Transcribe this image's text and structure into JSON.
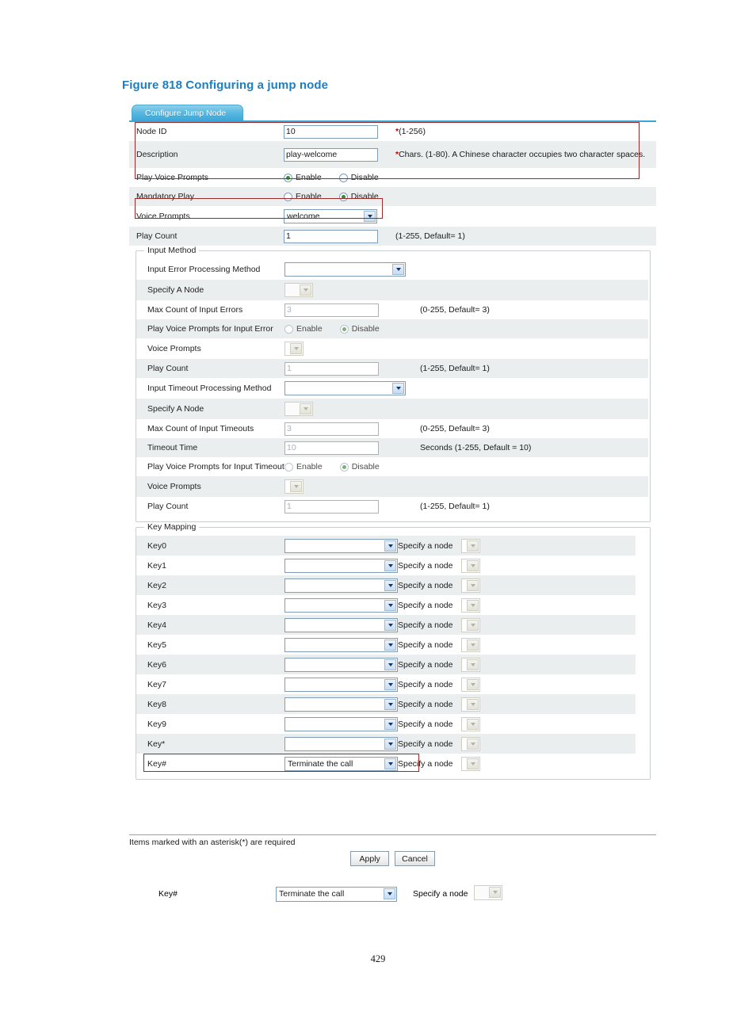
{
  "figure": {
    "caption": "Figure 818 Configuring a jump node"
  },
  "tab": {
    "label": "Configure Jump Node"
  },
  "basic": {
    "rows": [
      {
        "label": "Node ID",
        "value": "10",
        "hint_asterisk": "*",
        "hint": "(1-256)"
      },
      {
        "label": "Description",
        "value": "play-welcome",
        "hint_asterisk": "*",
        "hint": "Chars. (1-80). A Chinese character occupies two character spaces."
      },
      {
        "label": "Play Voice Prompts",
        "enable_label": "Enable",
        "disable_label": "Disable",
        "selected": "Enable"
      },
      {
        "label": "Mandatory Play",
        "enable_label": "Enable",
        "disable_label": "Disable",
        "selected": "Disable"
      },
      {
        "label": "Voice Prompts",
        "value": "welcome"
      },
      {
        "label": "Play Count",
        "value": "1",
        "hint": "(1-255, Default= 1)"
      }
    ]
  },
  "input_method": {
    "legend": "Input Method",
    "rows": [
      {
        "label": "Input Error Processing Method",
        "value": ""
      },
      {
        "label": "Specify A Node",
        "value": ""
      },
      {
        "label": "Max Count of Input Errors",
        "value": "3",
        "hint": "(0-255, Default= 3)"
      },
      {
        "label": "Play Voice Prompts for Input Error",
        "enable_label": "Enable",
        "disable_label": "Disable",
        "selected": "Disable"
      },
      {
        "label": "Voice Prompts",
        "value": ""
      },
      {
        "label": "Play Count",
        "value": "1",
        "hint": "(1-255, Default= 1)"
      },
      {
        "label": "Input Timeout Processing Method",
        "value": ""
      },
      {
        "label": "Specify A Node",
        "value": ""
      },
      {
        "label": "Max Count of Input Timeouts",
        "value": "3",
        "hint": "(0-255, Default= 3)"
      },
      {
        "label": "Timeout Time",
        "value": "10",
        "hint": "Seconds (1-255, Default = 10)"
      },
      {
        "label": "Play Voice Prompts for Input Timeout",
        "enable_label": "Enable",
        "disable_label": "Disable",
        "selected": "Disable"
      },
      {
        "label": "Voice Prompts",
        "value": ""
      },
      {
        "label": "Play Count",
        "value": "1",
        "hint": "(1-255, Default= 1)"
      }
    ]
  },
  "key_mapping": {
    "legend": "Key Mapping",
    "specify_node_label": "Specify a node",
    "rows": [
      {
        "label": "Key0",
        "value": ""
      },
      {
        "label": "Key1",
        "value": ""
      },
      {
        "label": "Key2",
        "value": ""
      },
      {
        "label": "Key3",
        "value": ""
      },
      {
        "label": "Key4",
        "value": ""
      },
      {
        "label": "Key5",
        "value": ""
      },
      {
        "label": "Key6",
        "value": ""
      },
      {
        "label": "Key7",
        "value": ""
      },
      {
        "label": "Key8",
        "value": ""
      },
      {
        "label": "Key9",
        "value": ""
      },
      {
        "label": "Key*",
        "value": ""
      },
      {
        "label": "Key#",
        "value": "Terminate the call"
      }
    ]
  },
  "footer": {
    "required_note": "Items marked with an asterisk(*) are required",
    "apply_label": "Apply",
    "cancel_label": "Cancel"
  },
  "standalone": {
    "label": "Key#",
    "value": "Terminate the call",
    "specify_node_label": "Specify a node"
  },
  "page": {
    "number": "429"
  },
  "colors": {
    "accent_blue": "#1b7fc4",
    "tab_blue": "#3aa6d8",
    "highlight_red": "#9c2a2a",
    "asterisk_red": "#c00000",
    "zebra_gray": "#ebeeee",
    "radio_dot_green": "#2f8f2f"
  }
}
